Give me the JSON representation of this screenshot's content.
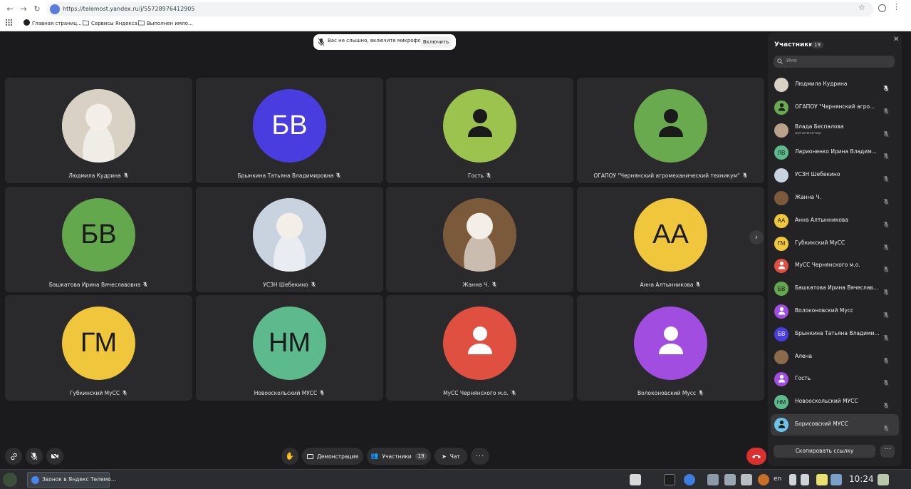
{
  "browser": {
    "url": "https://telemost.yandex.ru/j/55728976412905",
    "bookmarks": [
      "Главная страниц...",
      "Сервисы Яндекса",
      "Выполнен имло..."
    ]
  },
  "banner": {
    "text": "Вас не слышно, включите микрофон",
    "button": "Включить"
  },
  "tiles": [
    {
      "name": "Людмила Кудрина",
      "initials": "",
      "color": "#d9d2c4",
      "kind": "photo"
    },
    {
      "name": "Брынкина Татьяна Владимировна",
      "initials": "БВ",
      "color": "#4a3de0",
      "kind": "initials",
      "light": true
    },
    {
      "name": "Гость",
      "initials": "",
      "color": "#9bc34e",
      "kind": "person"
    },
    {
      "name": "ОГАПОУ \"Чернянский агромеханический техникум\"",
      "initials": "",
      "color": "#6aaa4f",
      "kind": "person"
    },
    {
      "name": "Башкатова Ирина Вячеславовна",
      "initials": "БВ",
      "color": "#63a84c",
      "kind": "initials"
    },
    {
      "name": "УСЗН Шебекино",
      "initials": "",
      "color": "#c9d3e0",
      "kind": "photo"
    },
    {
      "name": "Жанна Ч.",
      "initials": "",
      "color": "#7a5a3a",
      "kind": "photo"
    },
    {
      "name": "Анна Алтынникова",
      "initials": "АА",
      "color": "#f0c73c",
      "kind": "initials"
    },
    {
      "name": "Губкинский МуСС",
      "initials": "ГМ",
      "color": "#f0c73c",
      "kind": "initials"
    },
    {
      "name": "Новооскольский МУСС",
      "initials": "НМ",
      "color": "#5dba8c",
      "kind": "initials"
    },
    {
      "name": "МуСС Чернянского м.о.",
      "initials": "",
      "color": "#e05040",
      "kind": "person"
    },
    {
      "name": "Волоконовский Мусс",
      "initials": "",
      "color": "#a04de0",
      "kind": "person"
    }
  ],
  "toolbar": {
    "demo": "Демонстрация",
    "participants": "Участники",
    "participants_count": "19",
    "chat": "Чат"
  },
  "panel": {
    "title": "Участники",
    "count": "19",
    "search_placeholder": "Имя",
    "copy_link": "Скопировать ссылку",
    "participants": [
      {
        "name": "Людмила Кудрина",
        "initials": "",
        "color": "#d9d2c4",
        "role": ""
      },
      {
        "name": "ОГАПОУ \"Чернянский агро...",
        "initials": "",
        "color": "#6aaa4f",
        "role": ""
      },
      {
        "name": "Влада Беспалова",
        "initials": "",
        "color": "#b9a18a",
        "role": "организатор"
      },
      {
        "name": "Ларионенко Ирина Владим...",
        "initials": "ЛВ",
        "color": "#5dba8c",
        "role": ""
      },
      {
        "name": "УСЗН Шебекино",
        "initials": "",
        "color": "#c9d3e0",
        "role": ""
      },
      {
        "name": "Жанна Ч.",
        "initials": "",
        "color": "#7a5a3a",
        "role": ""
      },
      {
        "name": "Анна Алтынникова",
        "initials": "АА",
        "color": "#f0c73c",
        "role": ""
      },
      {
        "name": "Губкинский МуСС",
        "initials": "ГМ",
        "color": "#f0c73c",
        "role": ""
      },
      {
        "name": "МуСС Чернянского м.о.",
        "initials": "",
        "color": "#e05040",
        "role": ""
      },
      {
        "name": "Башкатова Ирина Вячеслав...",
        "initials": "БВ",
        "color": "#63a84c",
        "role": ""
      },
      {
        "name": "Волоконовский Мусс",
        "initials": "",
        "color": "#a04de0",
        "role": ""
      },
      {
        "name": "Брынкина Татьяна Владими...",
        "initials": "БВ",
        "color": "#4a3de0",
        "role": "",
        "light": true
      },
      {
        "name": "Алена",
        "initials": "",
        "color": "#8a6a4a",
        "role": ""
      },
      {
        "name": "Гость",
        "initials": "",
        "color": "#a04de0",
        "role": ""
      },
      {
        "name": "Новооскольский МУСС",
        "initials": "НМ",
        "color": "#5dba8c",
        "role": ""
      },
      {
        "name": "Борисовский МУСС",
        "initials": "",
        "color": "#6ec3e8",
        "role": ""
      }
    ]
  },
  "taskbar": {
    "window_title": "Звонок в Яндекс Телемо...",
    "lang": "en",
    "time": "10:24"
  }
}
